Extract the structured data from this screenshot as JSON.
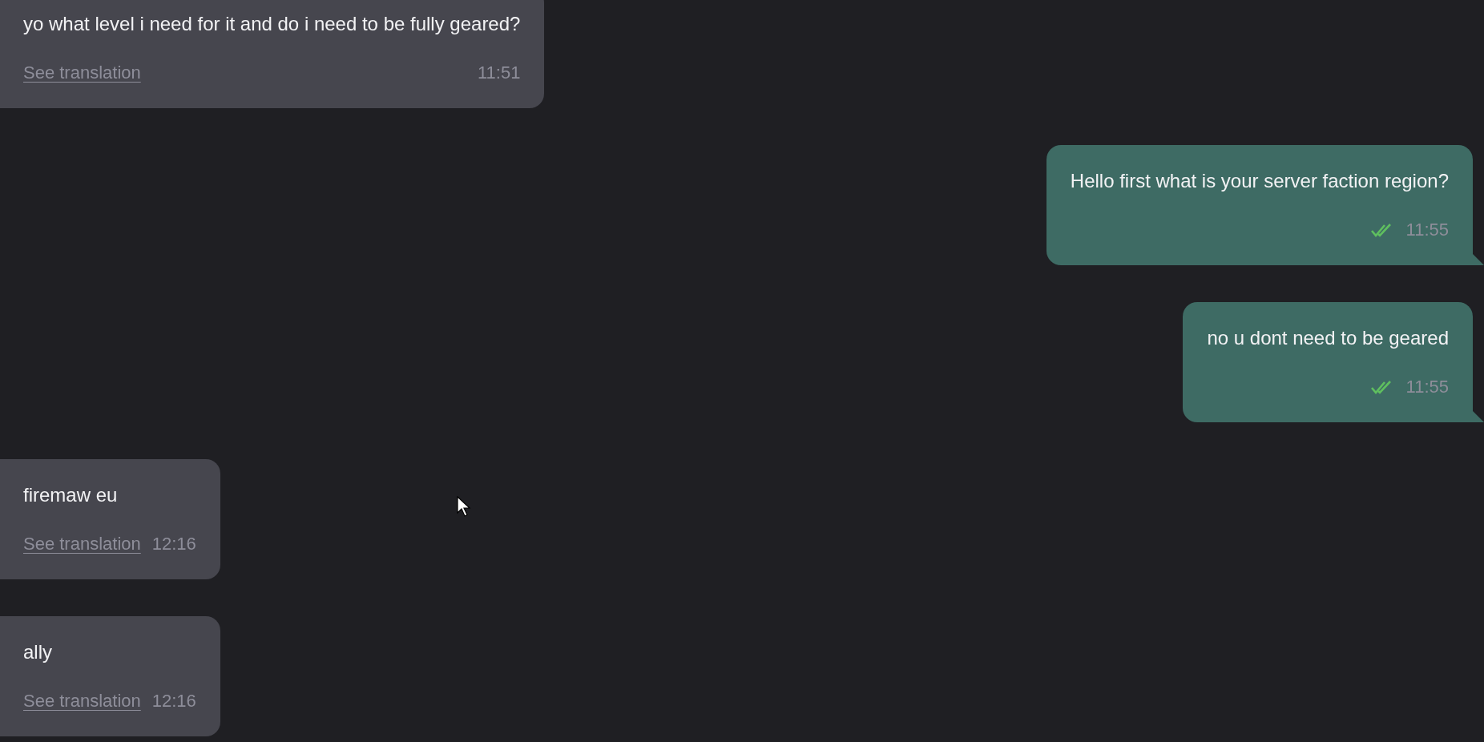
{
  "messages": [
    {
      "kind": "incoming",
      "text": "yo what level i need for it and do i need to be fully geared?",
      "link": "See translation",
      "time": "11:51"
    },
    {
      "kind": "outgoing",
      "text": "Hello first what is your server faction region?",
      "time": "11:55",
      "read": true
    },
    {
      "kind": "outgoing",
      "text": "no u dont need to be geared",
      "time": "11:55",
      "read": true
    },
    {
      "kind": "incoming",
      "text": "firemaw eu",
      "link": "See translation",
      "time": "12:16"
    },
    {
      "kind": "incoming",
      "text": "ally",
      "link": "See translation",
      "time": "12:16"
    }
  ]
}
